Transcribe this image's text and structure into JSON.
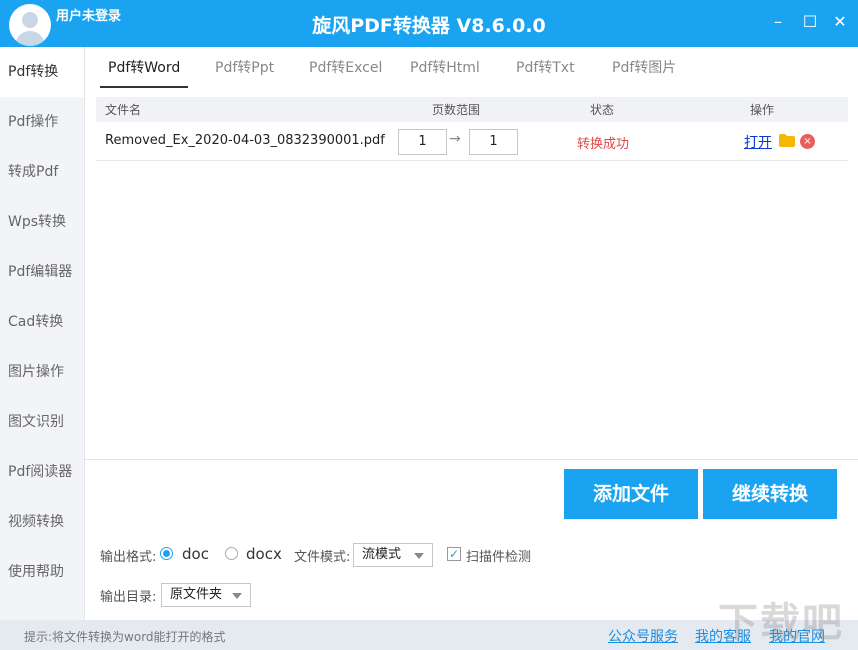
{
  "header": {
    "username": "用户未登录",
    "app_title": "旋风PDF转换器 V8.6.0.0",
    "min_label": "–",
    "max_label": "☐",
    "close_label": "✕"
  },
  "sidebar": {
    "items": [
      {
        "label": "Pdf转换"
      },
      {
        "label": "Pdf操作"
      },
      {
        "label": "转成Pdf"
      },
      {
        "label": "Wps转换"
      },
      {
        "label": "Pdf编辑器"
      },
      {
        "label": "Cad转换"
      },
      {
        "label": "图片操作"
      },
      {
        "label": "图文识别"
      },
      {
        "label": "Pdf阅读器"
      },
      {
        "label": "视频转换"
      },
      {
        "label": "使用帮助"
      }
    ],
    "active": "Pdf转换"
  },
  "tabs": [
    {
      "label": "Pdf转Word"
    },
    {
      "label": "Pdf转Ppt"
    },
    {
      "label": "Pdf转Excel"
    },
    {
      "label": "Pdf转Html"
    },
    {
      "label": "Pdf转Txt"
    },
    {
      "label": "Pdf转图片"
    }
  ],
  "table": {
    "columns": [
      "文件名",
      "页数范围",
      "状态",
      "操作"
    ],
    "rows": [
      {
        "file_name": "Removed_Ex_2020-04-03_0832390001.pdf",
        "page_from": "1",
        "page_to": "1",
        "arrow": "→",
        "status": "转换成功",
        "open_label": "打开",
        "remove_label": "×"
      }
    ]
  },
  "actions": {
    "add_file": "添加文件",
    "continue_convert": "继续转换"
  },
  "options": {
    "format_label": "输出格式:",
    "format_options": [
      "doc",
      "docx"
    ],
    "format_selected": "doc",
    "mode_label": "文件模式:",
    "mode_value": "流模式",
    "scan_check_label": "扫描件检测",
    "scan_check_mark": "✓",
    "dir_label": "输出目录:",
    "dir_value": "原文件夹"
  },
  "statusbar": {
    "hint": "提示:将文件转换为word能打开的格式",
    "links": [
      "公众号服务",
      "我的客服",
      "我的官网"
    ]
  },
  "watermark": "下载吧",
  "colors": {
    "accent": "#1aa3f0",
    "status_success": "#e04848",
    "link": "#0a3ad0"
  }
}
